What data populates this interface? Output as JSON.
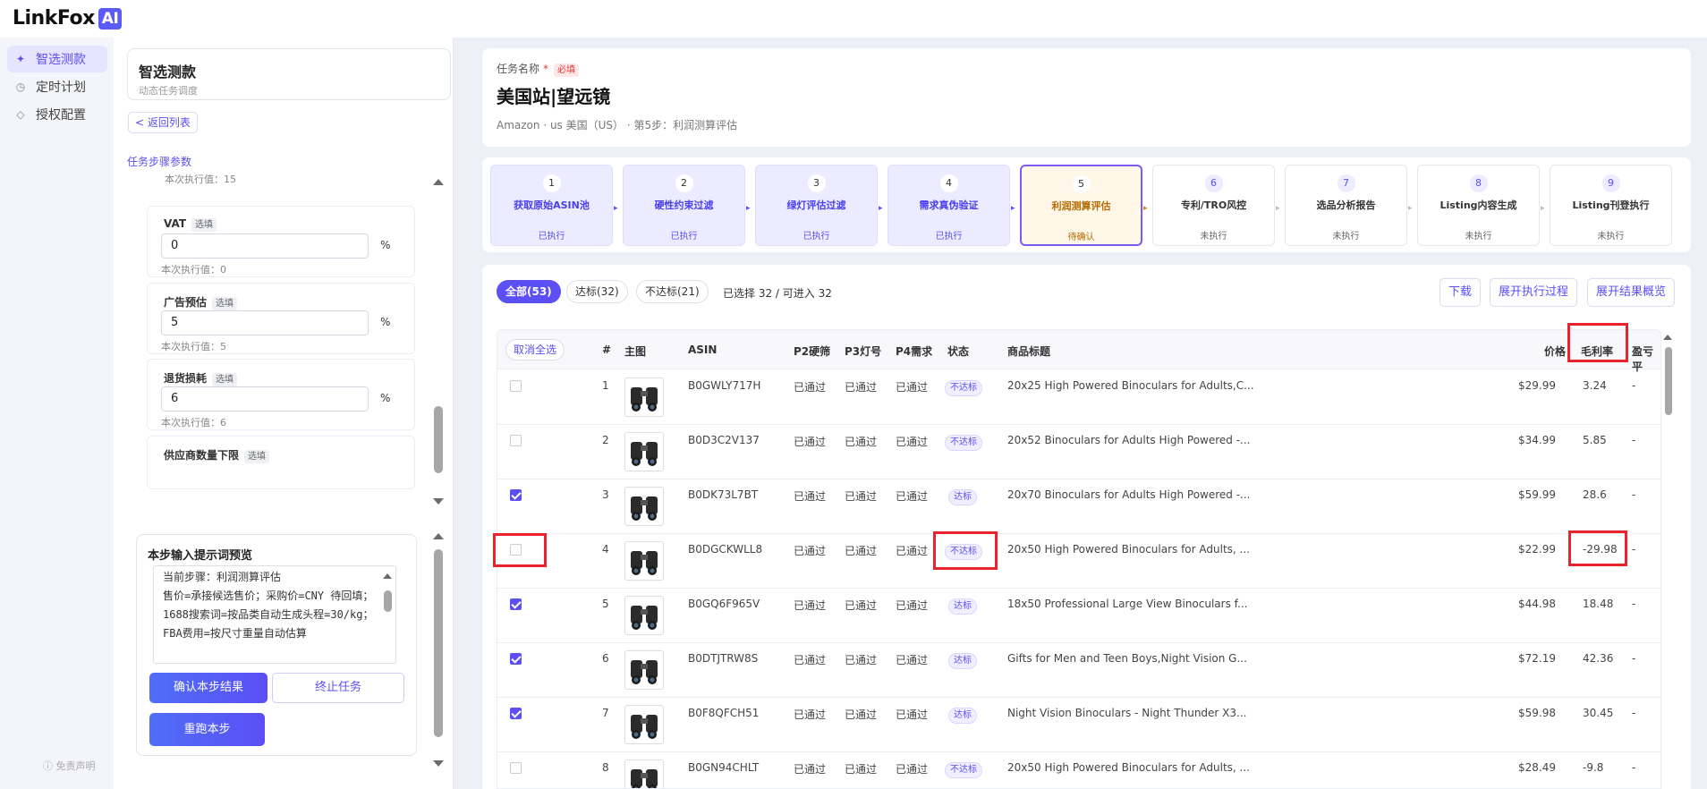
{
  "app": {
    "logo_text": "LinkFox",
    "logo_badge": "AI"
  },
  "sidebar": {
    "items": [
      {
        "label": "智选测款",
        "icon": "sparkle-icon",
        "active": true
      },
      {
        "label": "定时计划",
        "icon": "clock-icon",
        "active": false
      },
      {
        "label": "授权配置",
        "icon": "key-icon",
        "active": false
      }
    ],
    "disclaimer": "ⓘ 免责声明"
  },
  "left_panel": {
    "title": "智选测款",
    "subtitle": "动态任务调度",
    "back": "< 返回列表",
    "steps_params": "任务步骤参数",
    "top_current": "本次执行值：15",
    "params": [
      {
        "label": "VAT",
        "tag": "选填",
        "value": "0",
        "unit": "%",
        "current": "本次执行值：0"
      },
      {
        "label": "广告预估",
        "tag": "选填",
        "value": "5",
        "unit": "%",
        "current": "本次执行值：5"
      },
      {
        "label": "退货损耗",
        "tag": "选填",
        "value": "6",
        "unit": "%",
        "current": "本次执行值：6"
      },
      {
        "label": "供应商数量下限",
        "tag": "选填"
      }
    ],
    "prompt_title": "本步输入提示词预览",
    "prompt_text": "当前步骤：利润测算评估\n售价=承接候选售价；采购价=CNY 待回填；1688搜索词=按品类自动生成头程=30/kg；FBA费用=按尺寸重量自动估算",
    "confirm": "确认本步结果",
    "stop": "终止任务",
    "rerun": "重跑本步"
  },
  "task": {
    "label": "任务名称",
    "required_star": "*",
    "required_tag": "必填",
    "name": "美国站|望远镜",
    "meta": "Amazon · us 美国（US） · 第5步：利润测算评估"
  },
  "steps": [
    {
      "num": "1",
      "name": "获取原始ASIN池",
      "status": "已执行",
      "state": "done"
    },
    {
      "num": "2",
      "name": "硬性约束过滤",
      "status": "已执行",
      "state": "done"
    },
    {
      "num": "3",
      "name": "绿灯评估过滤",
      "status": "已执行",
      "state": "done"
    },
    {
      "num": "4",
      "name": "需求真伪验证",
      "status": "已执行",
      "state": "done"
    },
    {
      "num": "5",
      "name": "利润测算评估",
      "status": "待确认",
      "state": "active"
    },
    {
      "num": "6",
      "name": "专利/TRO风控",
      "status": "未执行",
      "state": "todo"
    },
    {
      "num": "7",
      "name": "选品分析报告",
      "status": "未执行",
      "state": "todo"
    },
    {
      "num": "8",
      "name": "Listing内容生成",
      "status": "未执行",
      "state": "todo"
    },
    {
      "num": "9",
      "name": "Listing刊登执行",
      "status": "未执行",
      "state": "todo"
    }
  ],
  "tabs": [
    {
      "label": "全部(53)",
      "active": true
    },
    {
      "label": "达标(32)",
      "active": false
    },
    {
      "label": "不达标(21)",
      "active": false
    }
  ],
  "selection_info": "已选择 32 / 可进入 32",
  "actions": [
    "下载",
    "展开执行过程",
    "展开结果概览"
  ],
  "table": {
    "unselect_all": "取消全选",
    "headers": {
      "idx": "#",
      "img": "主图",
      "asin": "ASIN",
      "p2": "P2硬筛",
      "p3": "P3灯号",
      "p4": "P4需求",
      "status": "状态",
      "title": "商品标题",
      "price": "价格",
      "margin": "毛利率",
      "profit": "盈亏平"
    },
    "rows": [
      {
        "idx": "1",
        "asin": "B0GWLY717H",
        "p2": "已通过",
        "p3": "已通过",
        "p4": "已通过",
        "status": "不达标",
        "title": "20x25 High Powered Binoculars for Adults,C...",
        "price": "$29.99",
        "margin": "3.24",
        "profit": "-",
        "checked": false
      },
      {
        "idx": "2",
        "asin": "B0D3C2V137",
        "p2": "已通过",
        "p3": "已通过",
        "p4": "已通过",
        "status": "不达标",
        "title": "20x52 Binoculars for Adults High Powered -...",
        "price": "$34.99",
        "margin": "5.85",
        "profit": "-",
        "checked": false
      },
      {
        "idx": "3",
        "asin": "B0DK73L7BT",
        "p2": "已通过",
        "p3": "已通过",
        "p4": "已通过",
        "status": "达标",
        "title": "20x70 Binoculars for Adults High Powered -...",
        "price": "$59.99",
        "margin": "28.6",
        "profit": "-",
        "checked": true
      },
      {
        "idx": "4",
        "asin": "B0DGCKWLL8",
        "p2": "已通过",
        "p3": "已通过",
        "p4": "已通过",
        "status": "不达标",
        "title": "20x50 High Powered Binoculars for Adults, ...",
        "price": "$22.99",
        "margin": "-29.98",
        "profit": "-",
        "checked": false
      },
      {
        "idx": "5",
        "asin": "B0GQ6F965V",
        "p2": "已通过",
        "p3": "已通过",
        "p4": "已通过",
        "status": "达标",
        "title": "18x50 Professional Large View Binoculars f...",
        "price": "$44.98",
        "margin": "18.48",
        "profit": "-",
        "checked": true
      },
      {
        "idx": "6",
        "asin": "B0DTJTRW8S",
        "p2": "已通过",
        "p3": "已通过",
        "p4": "已通过",
        "status": "达标",
        "title": "Gifts for Men and Teen Boys,Night Vision G...",
        "price": "$72.19",
        "margin": "42.36",
        "profit": "-",
        "checked": true
      },
      {
        "idx": "7",
        "asin": "B0F8QFCH51",
        "p2": "已通过",
        "p3": "已通过",
        "p4": "已通过",
        "status": "达标",
        "title": "Night Vision Binoculars - Night Thunder X3...",
        "price": "$59.98",
        "margin": "30.45",
        "profit": "-",
        "checked": true
      },
      {
        "idx": "8",
        "asin": "B0GN94CHLT",
        "p2": "已通过",
        "p3": "已通过",
        "p4": "已通过",
        "status": "不达标",
        "title": "20x50 High Powered Binoculars for Adults, ...",
        "price": "$28.49",
        "margin": "-9.8",
        "profit": "-",
        "checked": false
      }
    ]
  },
  "highlight_color": "#e8232b",
  "accent_color": "#5b4ff5"
}
